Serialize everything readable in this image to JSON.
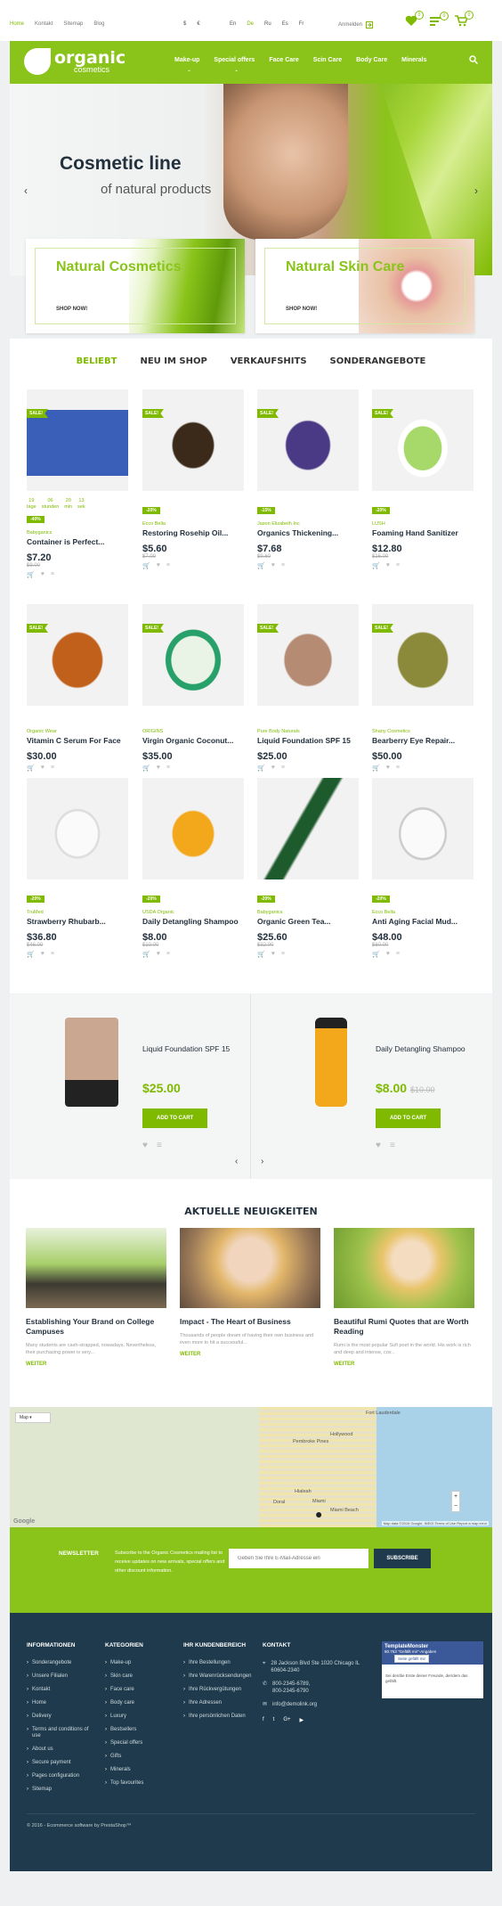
{
  "topbar": {
    "links": [
      "Home",
      "Kontakt",
      "Sitemap",
      "Blog"
    ],
    "currencies": [
      "$",
      "€"
    ],
    "languages": [
      "En",
      "De",
      "Ru",
      "Es",
      "Fr"
    ],
    "active_language": "De",
    "login": "Anmelden",
    "wishlist_count": "0",
    "compare_count": "0",
    "cart_count": "0"
  },
  "logo": {
    "title": "organic",
    "subtitle": "cosmetics"
  },
  "nav": {
    "items": [
      "Make-up",
      "Special offers",
      "Face Care",
      "Scin Care",
      "Body Care",
      "Minerals"
    ]
  },
  "hero": {
    "title": "Cosmetic line",
    "subtitle": "of natural products"
  },
  "promos": [
    {
      "title": "Natural Cosmetics",
      "button": "SHOP NOW!"
    },
    {
      "title": "Natural Skin Care",
      "button": "SHOP NOW!"
    }
  ],
  "tabs": [
    "BELIEBT",
    "NEU IM SHOP",
    "VERKAUFSHITS",
    "SONDERANGEBOTE"
  ],
  "products": [
    {
      "badge": "SALE!",
      "disc": "-40%",
      "brand": "Babyganics",
      "name": "Container is Perfect...",
      "price": "$7.20",
      "old": "$9.00",
      "countdown": true
    },
    {
      "badge": "SALE!",
      "disc": "-20%",
      "brand": "Ecco Bella",
      "name": "Restoring Rosehip Oil...",
      "price": "$5.60",
      "old": "$7.00"
    },
    {
      "badge": "SALE!",
      "disc": "-15%",
      "brand": "Jason Elizabeth Inc",
      "name": "Organics Thickening...",
      "price": "$7.68",
      "old": "$9.60"
    },
    {
      "badge": "SALE!",
      "disc": "-20%",
      "brand": "LUSH",
      "name": "Foaming Hand Sanitizer",
      "price": "$12.80",
      "old": "$16.00"
    },
    {
      "badge": "SALE!",
      "disc": "",
      "brand": "Organic Wear",
      "name": "Vitamin C Serum For Face",
      "price": "$30.00",
      "old": ""
    },
    {
      "badge": "SALE!",
      "disc": "",
      "brand": "ORIGINS",
      "name": "Virgin Organic Coconut...",
      "price": "$35.00",
      "old": ""
    },
    {
      "badge": "SALE!",
      "disc": "",
      "brand": "Pure Body Naturals",
      "name": "Liquid Foundation SPF 15",
      "price": "$25.00",
      "old": ""
    },
    {
      "badge": "SALE!",
      "disc": "",
      "brand": "Shany Cosmetics",
      "name": "Bearberry Eye Repair...",
      "price": "$50.00",
      "old": ""
    },
    {
      "badge": "",
      "disc": "-20%",
      "brand": "TruMed",
      "name": "Strawberry Rhubarb...",
      "price": "$36.80",
      "old": "$46.00"
    },
    {
      "badge": "",
      "disc": "-20%",
      "brand": "USDA Organic",
      "name": "Daily Detangling Shampoo",
      "price": "$8.00",
      "old": "$10.00"
    },
    {
      "badge": "",
      "disc": "-20%",
      "brand": "Babyganics",
      "name": "Organic Green Tea...",
      "price": "$25.60",
      "old": "$32.00"
    },
    {
      "badge": "",
      "disc": "-20%",
      "brand": "Ecco Bella",
      "name": "Anti Aging Facial Mud...",
      "price": "$48.00",
      "old": "$60.00"
    }
  ],
  "countdown": [
    {
      "v": "19",
      "l": "tage"
    },
    {
      "v": "06",
      "l": "stunden"
    },
    {
      "v": "20",
      "l": "min"
    },
    {
      "v": "13",
      "l": "sek"
    }
  ],
  "featured": [
    {
      "name": "Liquid Foundation SPF 15",
      "price": "$25.00",
      "old": "",
      "button": "ADD TO CART"
    },
    {
      "name": "Daily Detangling Shampoo",
      "price": "$8.00",
      "old": "$10.00",
      "button": "ADD TO CART"
    }
  ],
  "news": {
    "title": "AKTUELLE NEUIGKEITEN",
    "posts": [
      {
        "title": "Establishing Your Brand on College Campuses",
        "desc": "Many students are cash-strapped, nowadays. Nevertheless, their purchasing power is very...",
        "more": "WEITER"
      },
      {
        "title": "Impact - The Heart of Business",
        "desc": "Thousands of people dream of having their own business and even more to hit a successful...",
        "more": "WEITER"
      },
      {
        "title": "Beautiful Rumi Quotes that are Worth Reading",
        "desc": "Rumi is the most popular Sufi poet in the world. His work is rich and deep and intense, cov...",
        "more": "WEITER"
      }
    ]
  },
  "map": {
    "type_label": "Map",
    "places": [
      "Fort Lauderdale",
      "Pembroke Pines",
      "Hollywood",
      "Hialeah",
      "Miami",
      "Miami Beach",
      "Doral"
    ],
    "attribution": "Map data ©2016 Google, INEGI",
    "terms": "Terms of Use",
    "report": "Report a map error",
    "google": "Google"
  },
  "newsletter": {
    "label": "NEWSLETTER",
    "desc": "Subscribe to the Organic Cosmetics mailing list to receive updates on new arrivals, special offers and other discount information.",
    "placeholder": "Geben Sie Ihre E-Mail-Adresse ein",
    "button": "SUBSCRIBE"
  },
  "footer": {
    "info_title": "INFORMATIONEN",
    "info": [
      "Sonderangebote",
      "Unsere Filialen",
      "Kontakt",
      "Home",
      "Delivery",
      "Terms and conditions of use",
      "About us",
      "Secure payment",
      "Pages configuration",
      "Sitemap"
    ],
    "cat_title": "KATEGORIEN",
    "cats": [
      "Make-up",
      "Skin care",
      "Face care",
      "Body care",
      "Luxury",
      "Bestsellers",
      "Special offers",
      "Gifts",
      "Minerals",
      "Top favourites"
    ],
    "acc_title": "IHR KUNDENBEREICH",
    "acc": [
      "Ihre Bestellungen",
      "Ihre Warenrücksendungen",
      "Ihre Rückvergütungen",
      "Ihre Adressen",
      "Ihre persönlichen Daten"
    ],
    "contact_title": "KONTAKT",
    "address": "28 Jackson Blvd Ste 1020 Chicago IL 60604-2340",
    "phone1": "800-2345-6789,",
    "phone2": "800-2345-6790",
    "email": "info@demolink.org",
    "social": [
      "f",
      "t",
      "G+",
      "▶"
    ],
    "widget_title": "TemplateMonster",
    "widget_likes": "80.753 \"Gefällt mir\"-Angaben",
    "widget_like_btn": "Seite gefällt mir",
    "widget_text": "Sei der/die Erste deiner Freunde, der/dem das gefällt.",
    "copyright": "© 2016 - Ecommerce software by PrestaShop™"
  }
}
